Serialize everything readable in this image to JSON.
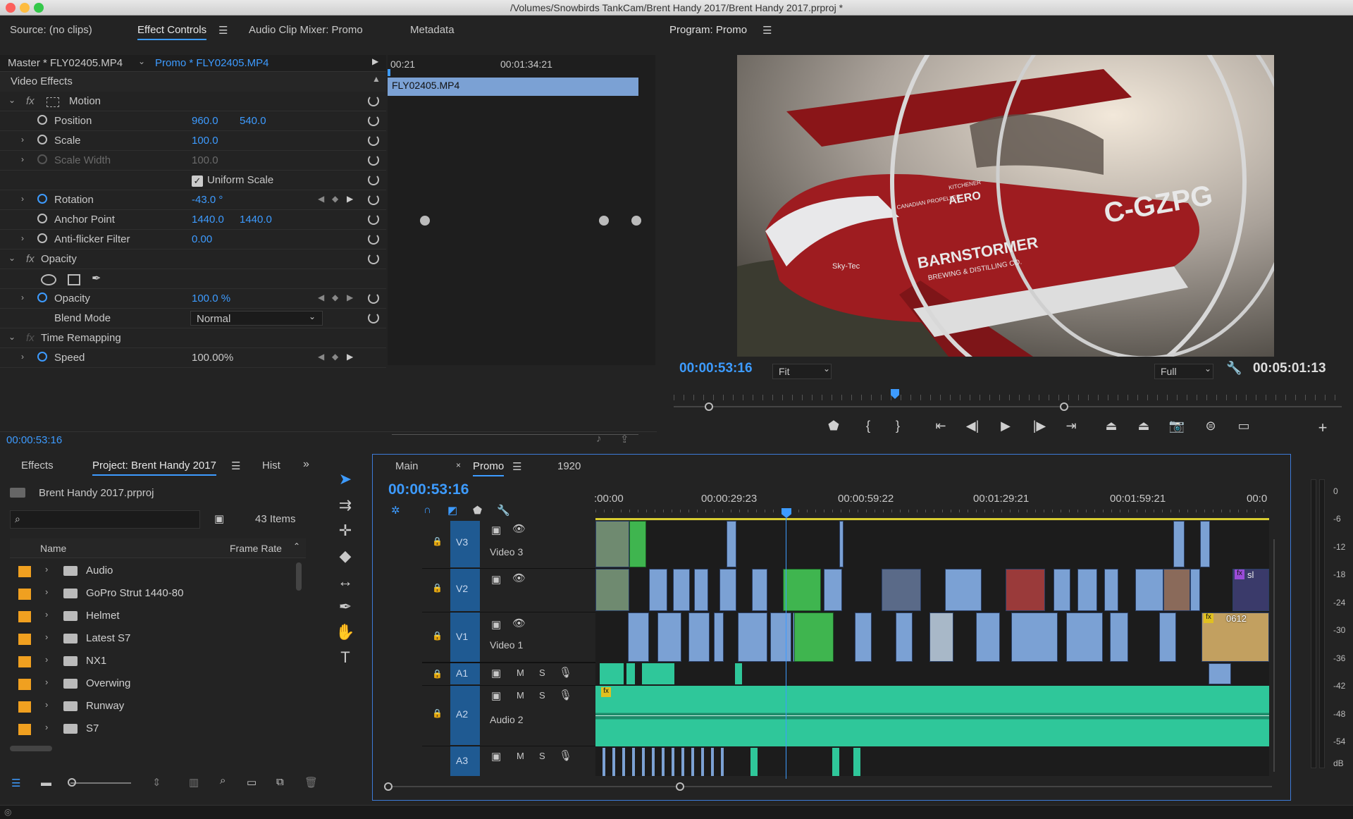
{
  "window": {
    "title": "/Volumes/Snowbirds TankCam/Brent Handy 2017/Brent Handy 2017.prproj *"
  },
  "source_panel": {
    "tabs": [
      "Source: (no clips)",
      "Effect Controls",
      "Audio Clip Mixer: Promo",
      "Metadata"
    ],
    "active_tab": "Effect Controls",
    "master_label": "Master * FLY02405.MP4",
    "sequence_label": "Promo * FLY02405.MP4",
    "ruler_start": "00:21",
    "ruler_mid": "00:01:34:21",
    "clip_name": "FLY02405.MP4",
    "section": "Video Effects",
    "rows": {
      "motion": "Motion",
      "position": {
        "label": "Position",
        "x": "960.0",
        "y": "540.0"
      },
      "scale": {
        "label": "Scale",
        "value": "100.0"
      },
      "scale_width": {
        "label": "Scale Width",
        "value": "100.0"
      },
      "uniform": "Uniform Scale",
      "rotation": {
        "label": "Rotation",
        "value": "-43.0 °"
      },
      "anchor": {
        "label": "Anchor Point",
        "x": "1440.0",
        "y": "1440.0"
      },
      "antiflicker": {
        "label": "Anti-flicker Filter",
        "value": "0.00"
      },
      "opacity_group": "Opacity",
      "opacity": {
        "label": "Opacity",
        "value": "100.0 %"
      },
      "blend": {
        "label": "Blend Mode",
        "value": "Normal"
      },
      "time_remap": "Time Remapping",
      "speed": {
        "label": "Speed",
        "value": "100.00%"
      }
    },
    "timecode": "00:00:53:16"
  },
  "program": {
    "title": "Program: Promo",
    "timecode": "00:00:53:16",
    "fit": "Fit",
    "quality": "Full",
    "duration": "00:05:01:13",
    "video_text": {
      "livery": "BARNSTORMER",
      "sub": "BREWING & DISTILLING CO.",
      "reg": "C-GZPG",
      "aero": "AERO",
      "kitchener": "KITCHENER",
      "canadian": "CANADIAN PROPELLER",
      "sky": "Sky-Tec"
    }
  },
  "project": {
    "tabs": [
      "Effects",
      "Project: Brent Handy 2017",
      "Hist"
    ],
    "file": "Brent Handy 2017.prproj",
    "items_count": "43 Items",
    "columns": [
      "Name",
      "Frame Rate"
    ],
    "folders": [
      "Audio",
      "GoPro Strut 1440-80",
      "Helmet",
      "Latest S7",
      "NX1",
      "Overwing",
      "Runway",
      "S7"
    ]
  },
  "timeline": {
    "tabs": [
      "Main",
      "Promo",
      "1920"
    ],
    "timecode": "00:00:53:16",
    "ruler": [
      ":00:00",
      "00:00:29:23",
      "00:00:59:22",
      "00:01:29:21",
      "00:01:59:21",
      "00:0"
    ],
    "tracks": [
      {
        "id": "V3",
        "name": "Video 3"
      },
      {
        "id": "V2",
        "name": ""
      },
      {
        "id": "V1",
        "name": "Video 1"
      },
      {
        "id": "A1",
        "name": ""
      },
      {
        "id": "A2",
        "name": "Audio 2"
      },
      {
        "id": "A3",
        "name": ""
      }
    ],
    "clip_labels": {
      "sl": "sl",
      "num": "0612"
    }
  },
  "meter": {
    "labels": [
      "0",
      "-6",
      "-12",
      "-18",
      "-24",
      "-30",
      "-36",
      "-42",
      "-48",
      "-54",
      "dB"
    ]
  },
  "colors": {
    "accent": "#3d9bff",
    "video_clip": "#7ba1d4",
    "green_clip": "#3fb54f",
    "audio_clip": "#2fc79a",
    "bin": "#f0a020"
  }
}
